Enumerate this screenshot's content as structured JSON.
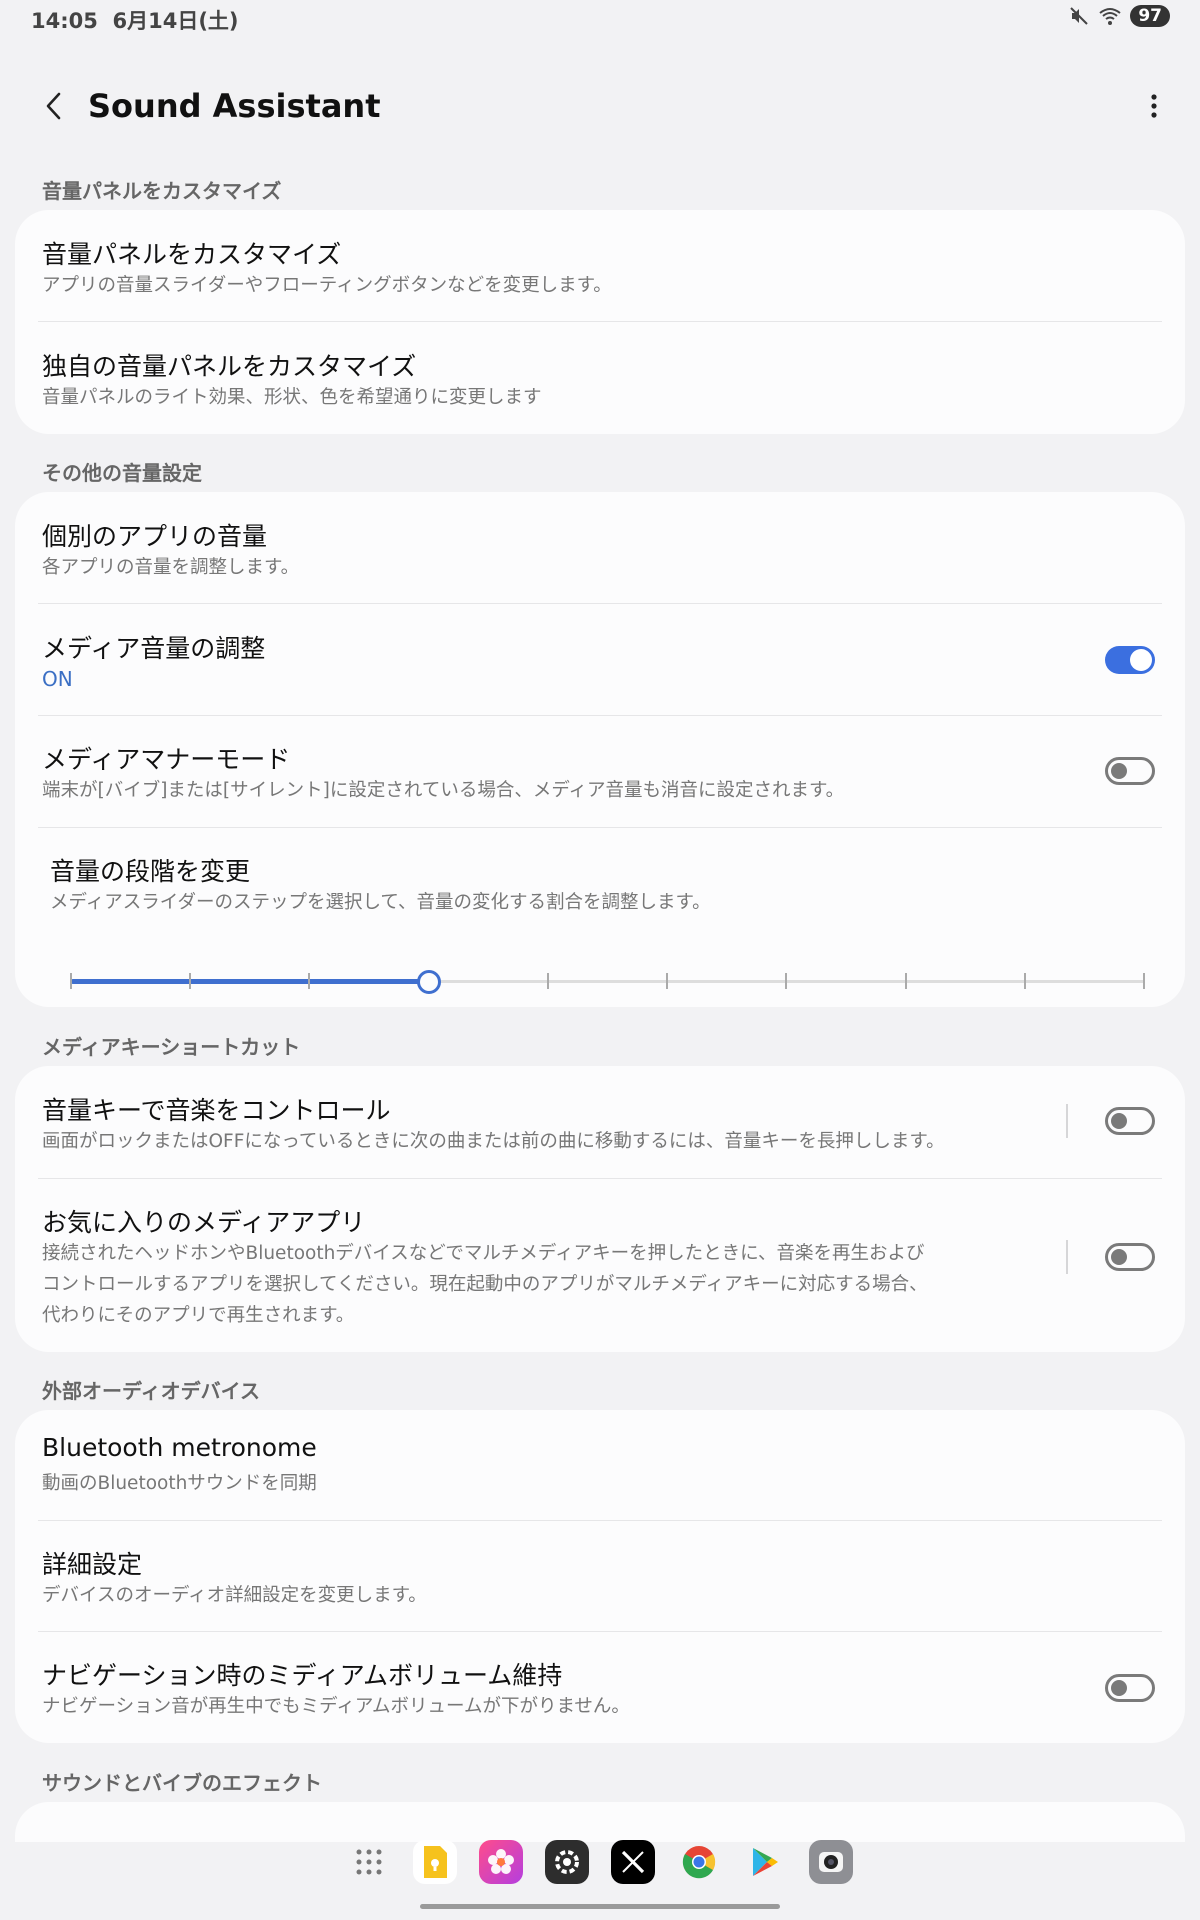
{
  "status": {
    "time": "14:05",
    "date": "6月14日(土)",
    "battery": "97"
  },
  "header": {
    "title": "Sound Assistant"
  },
  "sections": {
    "s1": "音量パネルをカスタマイズ",
    "s2": "その他の音量設定",
    "s3": "メディアキーショートカット",
    "s4": "外部オーディオデバイス",
    "s5": "サウンドとバイブのエフェクト"
  },
  "items": {
    "customize_panel": {
      "title": "音量パネルをカスタマイズ",
      "subtitle": "アプリの音量スライダーやフローティングボタンなどを変更します。"
    },
    "custom_panel": {
      "title": "独自の音量パネルをカスタマイズ",
      "subtitle": "音量パネルのライト効果、形状、色を希望通りに変更します"
    },
    "app_volume": {
      "title": "個別のアプリの音量",
      "subtitle": "各アプリの音量を調整します。"
    },
    "media_volume": {
      "title": "メディア音量の調整",
      "subtitle": "ON",
      "toggle": true
    },
    "media_manner": {
      "title": "メディアマナーモード",
      "subtitle": "端末が[バイブ]または[サイレント]に設定されている場合、メディア音量も消音に設定されます。",
      "toggle": false
    },
    "volume_steps": {
      "title": "音量の段階を変更",
      "subtitle": "メディアスライダーのステップを選択して、音量の変化する割合を調整します。",
      "min_label": "1",
      "max_label": "10",
      "min": 1,
      "max": 10,
      "value": 4
    },
    "volume_key_music": {
      "title": "音量キーで音楽をコントロール",
      "subtitle": "画面がロックまたはOFFになっているときに次の曲または前の曲に移動するには、音量キーを長押しします。",
      "toggle": false
    },
    "favorite_media": {
      "title": "お気に入りのメディアアプリ",
      "subtitle_1": "接続されたヘッドホンやBluetoothデバイスなどでマルチメディアキーを押したときに、音楽を再生および",
      "subtitle_2": "コントロールするアプリを選択してください。現在起動中のアプリがマルチメディアキーに対応する場合、",
      "subtitle_3": "代わりにそのアプリで再生されます。",
      "toggle": false
    },
    "bt_metronome": {
      "title": "Bluetooth metronome",
      "subtitle": "動画のBluetoothサウンドを同期"
    },
    "advanced": {
      "title": "詳細設定",
      "subtitle": "デバイスのオーディオ詳細設定を変更します。"
    },
    "nav_volume": {
      "title": "ナビゲーション時のミディアムボリューム維持",
      "subtitle": "ナビゲーション音が再生中でもミディアムボリュームが下がりません。",
      "toggle": false
    }
  },
  "dock": [
    "app-drawer-icon",
    "notes-app-icon",
    "gallery-app-icon",
    "settings-app-icon",
    "x-app-icon",
    "chrome-app-icon",
    "play-store-icon",
    "camera-app-icon"
  ],
  "colors": {
    "accent": "#3b6fe0",
    "background": "#f2f2f4",
    "card": "#fcfcfd"
  }
}
